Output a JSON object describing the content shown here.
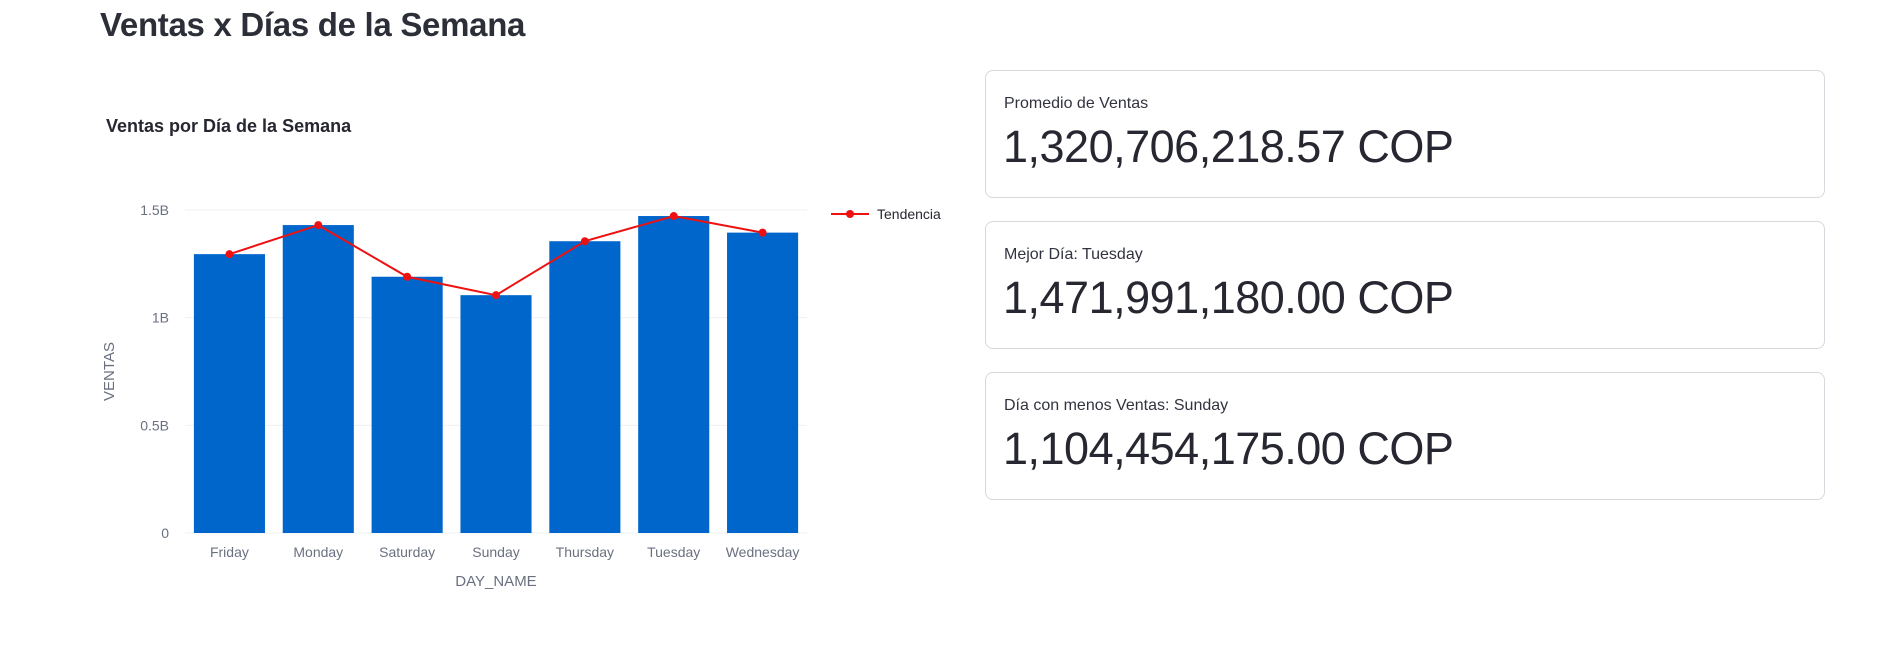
{
  "page": {
    "title": "Ventas x Días de la Semana"
  },
  "metrics": [
    {
      "label": "Promedio de Ventas",
      "value": "1,320,706,218.57 COP"
    },
    {
      "label": "Mejor Día: Tuesday",
      "value": "1,471,991,180.00 COP"
    },
    {
      "label": "Día con menos Ventas: Sunday",
      "value": "1,104,454,175.00 COP"
    }
  ],
  "colors": {
    "bar": "#0066cc",
    "trend": "#ee1111",
    "grid": "#eef0f3"
  },
  "chart_data": {
    "type": "bar",
    "title": "Ventas por Día de la Semana",
    "xlabel": "DAY_NAME",
    "ylabel": "VENTAS",
    "categories": [
      "Friday",
      "Monday",
      "Saturday",
      "Sunday",
      "Thursday",
      "Tuesday",
      "Wednesday"
    ],
    "values": [
      1295000000,
      1430000000,
      1190000000,
      1104454175,
      1355000000,
      1471991180,
      1395000000
    ],
    "ylim": [
      0,
      1500000000
    ],
    "yticks": [
      0,
      500000000,
      1000000000,
      1500000000
    ],
    "ytick_labels": [
      "0",
      "0.5B",
      "1B",
      "1.5B"
    ],
    "series": [
      {
        "name": "Tendencia",
        "type": "line",
        "values": [
          1295000000,
          1430000000,
          1190000000,
          1104454175,
          1355000000,
          1471991180,
          1395000000
        ]
      }
    ],
    "legend_position": "top-right",
    "grid": true
  }
}
